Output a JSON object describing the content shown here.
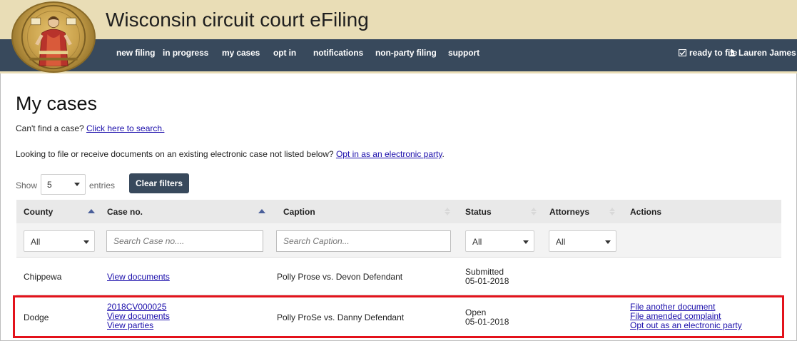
{
  "header": {
    "title": "Wisconsin circuit court eFiling",
    "nav": [
      {
        "label": "new filing"
      },
      {
        "label": "in progress"
      },
      {
        "label": "my cases"
      },
      {
        "label": "opt in"
      },
      {
        "label": "notifications"
      },
      {
        "label": "non-party filing"
      },
      {
        "label": "support"
      }
    ],
    "ready_to_file": "ready to file",
    "user": "Lauren James"
  },
  "main": {
    "title": "My cases",
    "search_prompt": "Can't find a case?",
    "search_link": "Click here to search.",
    "optin_prompt": "Looking to file or receive documents on an existing electronic case not listed below?",
    "optin_link": "Opt in as an electronic party",
    "optin_suffix": ".",
    "show_label": "Show",
    "entries_value": "5",
    "entries_label": "entries",
    "clear_filters": "Clear filters"
  },
  "table": {
    "columns": [
      "County",
      "Case no.",
      "Caption",
      "Status",
      "Attorneys",
      "Actions"
    ],
    "filters": {
      "county": "All",
      "case_placeholder": "Search Case no....",
      "caption_placeholder": "Search Caption...",
      "status": "All",
      "attorneys": "All"
    },
    "rows": [
      {
        "county": "Chippewa",
        "case_links": [
          "View documents"
        ],
        "caption": "Polly Prose vs. Devon Defendant",
        "status": "Submitted",
        "status_date": "05-01-2018",
        "actions": []
      },
      {
        "county": "Dodge",
        "case_links": [
          "2018CV000025",
          "View documents",
          "View parties"
        ],
        "caption": "Polly ProSe vs. Danny Defendant",
        "status": "Open",
        "status_date": "05-01-2018",
        "actions": [
          "File another document",
          "File amended complaint",
          "Opt out as an electronic party"
        ]
      }
    ]
  },
  "colors": {
    "header_bg": "#e9ddb6",
    "nav_bg": "#38495c",
    "highlight": "#e3121b",
    "link": "#1a0dab"
  }
}
